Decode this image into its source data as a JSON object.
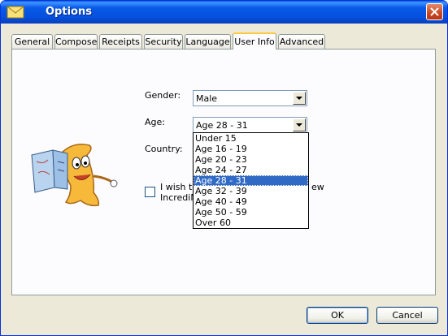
{
  "window": {
    "title": "Options"
  },
  "tabs": [
    {
      "label": "General"
    },
    {
      "label": "Compose"
    },
    {
      "label": "Receipts"
    },
    {
      "label": "Security"
    },
    {
      "label": "Language"
    },
    {
      "label": "User Info",
      "active": true
    },
    {
      "label": "Advanced"
    }
  ],
  "form": {
    "gender_label": "Gender:",
    "gender_value": "Male",
    "age_label": "Age:",
    "age_value": "Age 28 - 31",
    "country_label": "Country:",
    "checkbox_text_line1": "I wish to",
    "checkbox_text_line1_tail": "ew",
    "checkbox_text_line2": "IncrediM",
    "checkbox_checked": false
  },
  "age_dropdown": {
    "options": [
      "Under 15",
      "Age 16 - 19",
      "Age 20 - 23",
      "Age 24 - 27",
      "Age 28 - 31",
      "Age 32 - 39",
      "Age 40 - 49",
      "Age 50 - 59",
      "Over 60"
    ],
    "selected_index": 4
  },
  "buttons": {
    "ok_label": "OK",
    "cancel_label": "Cancel"
  },
  "icons": {
    "window_icon": "app-icon",
    "close_icon": "close-icon",
    "mascot": "mascot-illustration"
  },
  "colors": {
    "titlebar": "#0451dd",
    "selection": "#316ac5",
    "close": "#c94820",
    "active_tab_accent": "#ffc83c"
  }
}
